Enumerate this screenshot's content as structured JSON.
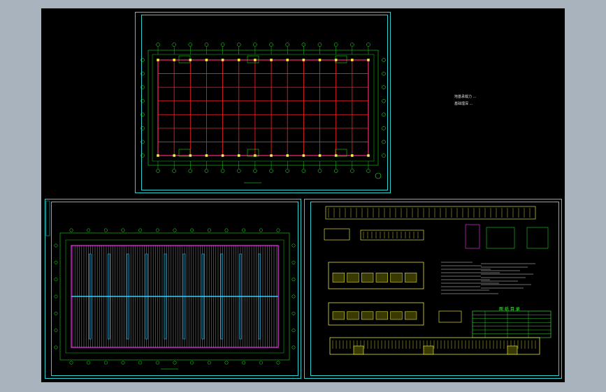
{
  "viewport": {
    "background": "#a8b3bd",
    "canvas_color": "#000000"
  },
  "colors": {
    "frame": "#2fd0d0",
    "grid": "#ff2020",
    "dims": "#20ff20",
    "magenta": "#ff30ff",
    "purlin": "#c8c8c8",
    "bay": "#30d0ff",
    "elevation": "#ffff40",
    "table": "#40ff40",
    "text": "#e0e0e0"
  },
  "sheets": [
    {
      "id": "foundation-plan",
      "notes": [
        "地基承载力 ...",
        "基础埋深 ..."
      ]
    },
    {
      "id": "roof-plan"
    },
    {
      "id": "elevations-and-details"
    }
  ],
  "sheet3": {
    "title_block_heading": "图 纸 目 录"
  }
}
